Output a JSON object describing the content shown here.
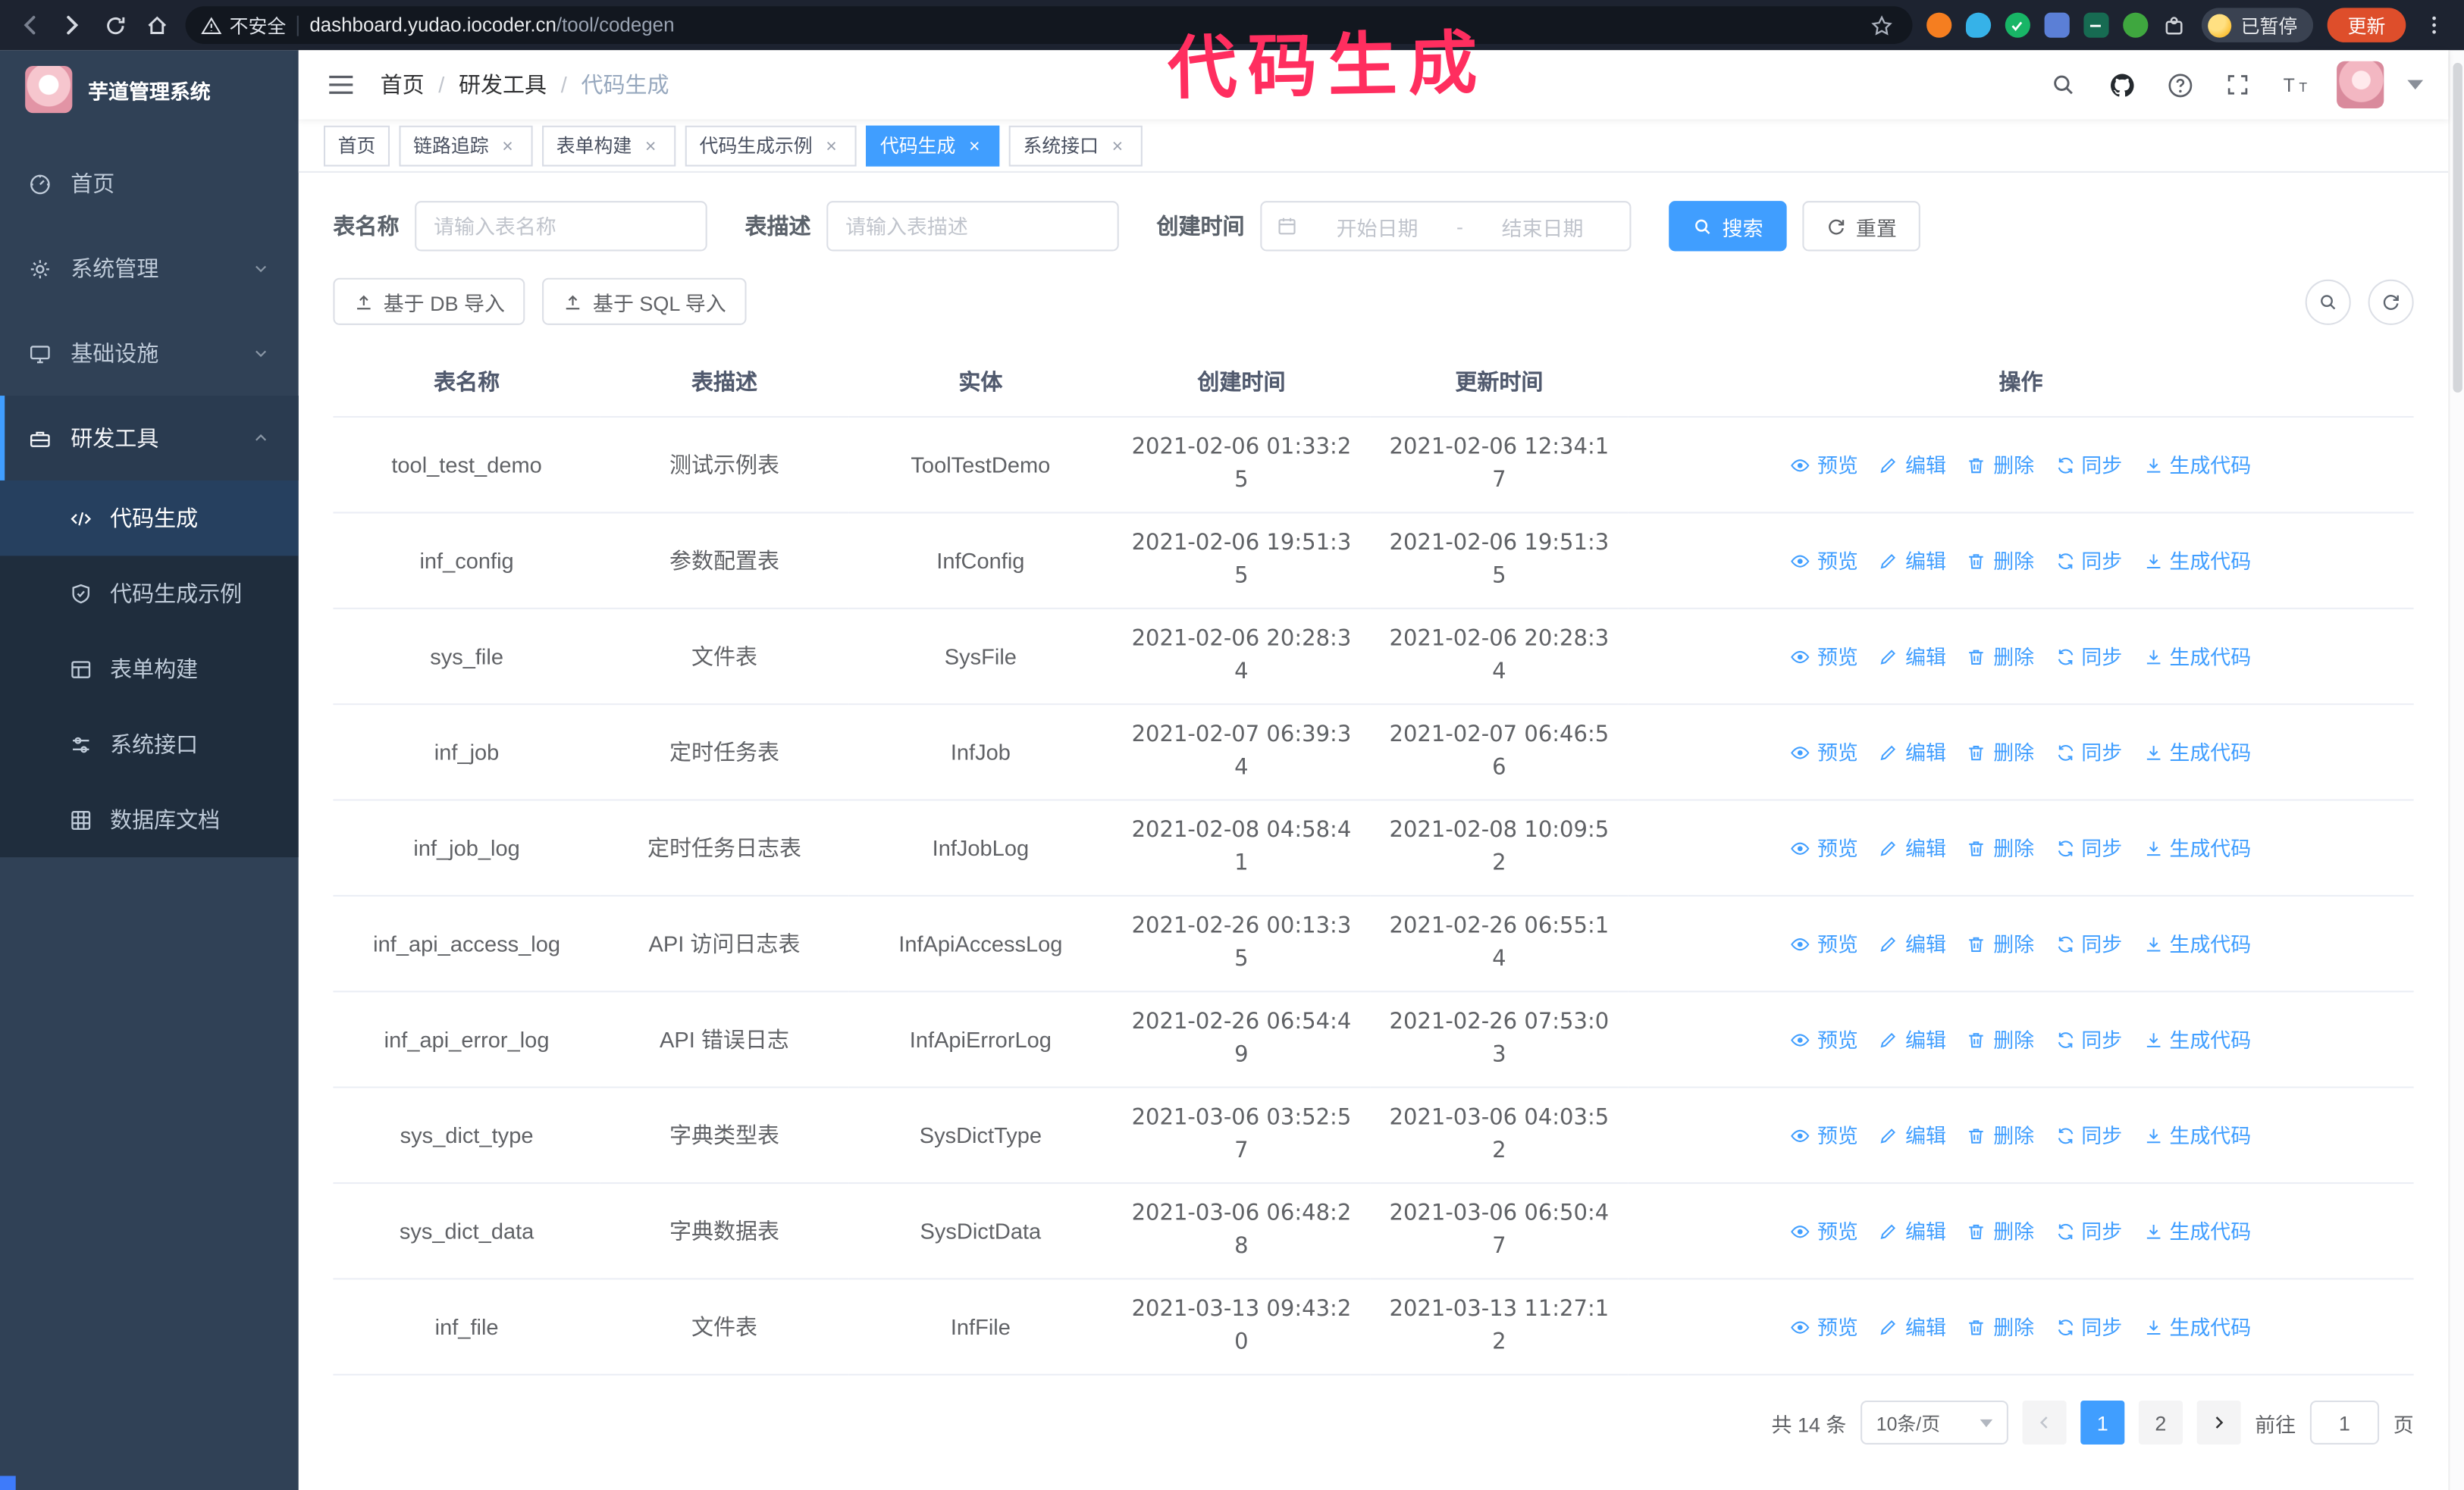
{
  "colors": {
    "accent": "#409eff",
    "sidebar_bg": "#304156",
    "submenu_bg": "#1f2d3d",
    "chrome_bg": "#1d2330",
    "update_button_bg": "#de4e2b",
    "annotation": "#ff2e5f"
  },
  "browser": {
    "security_label": "不安全",
    "url_host": "dashboard.yudao.iocoder.cn",
    "url_path": "/tool/codegen",
    "paused_badge": "已暂停",
    "update_button": "更新"
  },
  "annotation": {
    "text": "代码生成"
  },
  "sidebar": {
    "logo_title": "芋道管理系统",
    "items": [
      {
        "label": "首页"
      },
      {
        "label": "系统管理"
      },
      {
        "label": "基础设施"
      },
      {
        "label": "研发工具"
      }
    ],
    "sub_items": [
      {
        "label": "代码生成"
      },
      {
        "label": "代码生成示例"
      },
      {
        "label": "表单构建"
      },
      {
        "label": "系统接口"
      },
      {
        "label": "数据库文档"
      }
    ]
  },
  "header": {
    "breadcrumb": [
      "首页",
      "研发工具",
      "代码生成"
    ]
  },
  "tags": [
    {
      "label": "首页",
      "closable": false,
      "active": false
    },
    {
      "label": "链路追踪",
      "closable": true,
      "active": false
    },
    {
      "label": "表单构建",
      "closable": true,
      "active": false
    },
    {
      "label": "代码生成示例",
      "closable": true,
      "active": false
    },
    {
      "label": "代码生成",
      "closable": true,
      "active": true
    },
    {
      "label": "系统接口",
      "closable": true,
      "active": false
    }
  ],
  "search_form": {
    "table_name_label": "表名称",
    "table_name_placeholder": "请输入表名称",
    "table_desc_label": "表描述",
    "table_desc_placeholder": "请输入表描述",
    "create_time_label": "创建时间",
    "date_start_placeholder": "开始日期",
    "date_separator": "-",
    "date_end_placeholder": "结束日期",
    "search_button": "搜索",
    "reset_button": "重置"
  },
  "toolbar": {
    "import_db": "基于 DB 导入",
    "import_sql": "基于 SQL 导入"
  },
  "table": {
    "columns": [
      "表名称",
      "表描述",
      "实体",
      "创建时间",
      "更新时间",
      "操作"
    ],
    "actions": [
      "预览",
      "编辑",
      "删除",
      "同步",
      "生成代码"
    ],
    "rows": [
      {
        "name": "tool_test_demo",
        "desc": "测试示例表",
        "entity": "ToolTestDemo",
        "created": "2021-02-06 01:33:25",
        "updated": "2021-02-06 12:34:17"
      },
      {
        "name": "inf_config",
        "desc": "参数配置表",
        "entity": "InfConfig",
        "created": "2021-02-06 19:51:35",
        "updated": "2021-02-06 19:51:35"
      },
      {
        "name": "sys_file",
        "desc": "文件表",
        "entity": "SysFile",
        "created": "2021-02-06 20:28:34",
        "updated": "2021-02-06 20:28:34"
      },
      {
        "name": "inf_job",
        "desc": "定时任务表",
        "entity": "InfJob",
        "created": "2021-02-07 06:39:34",
        "updated": "2021-02-07 06:46:56"
      },
      {
        "name": "inf_job_log",
        "desc": "定时任务日志表",
        "entity": "InfJobLog",
        "created": "2021-02-08 04:58:41",
        "updated": "2021-02-08 10:09:52"
      },
      {
        "name": "inf_api_access_log",
        "desc": "API 访问日志表",
        "entity": "InfApiAccessLog",
        "created": "2021-02-26 00:13:35",
        "updated": "2021-02-26 06:55:14"
      },
      {
        "name": "inf_api_error_log",
        "desc": "API 错误日志",
        "entity": "InfApiErrorLog",
        "created": "2021-02-26 06:54:49",
        "updated": "2021-02-26 07:53:03"
      },
      {
        "name": "sys_dict_type",
        "desc": "字典类型表",
        "entity": "SysDictType",
        "created": "2021-03-06 03:52:57",
        "updated": "2021-03-06 04:03:52"
      },
      {
        "name": "sys_dict_data",
        "desc": "字典数据表",
        "entity": "SysDictData",
        "created": "2021-03-06 06:48:28",
        "updated": "2021-03-06 06:50:47"
      },
      {
        "name": "inf_file",
        "desc": "文件表",
        "entity": "InfFile",
        "created": "2021-03-13 09:43:20",
        "updated": "2021-03-13 11:27:12"
      }
    ]
  },
  "pagination": {
    "total": "共 14 条",
    "page_size": "10条/页",
    "pages": [
      "1",
      "2"
    ],
    "active_page": "1",
    "goto_label": "前往",
    "goto_value": "1",
    "goto_suffix": "页"
  },
  "icons": {
    "search": "magnifier",
    "reset": "refresh",
    "import": "upload",
    "preview": "eye",
    "edit": "pencil",
    "delete": "trash",
    "sync": "refresh-arrows",
    "generate": "download"
  }
}
